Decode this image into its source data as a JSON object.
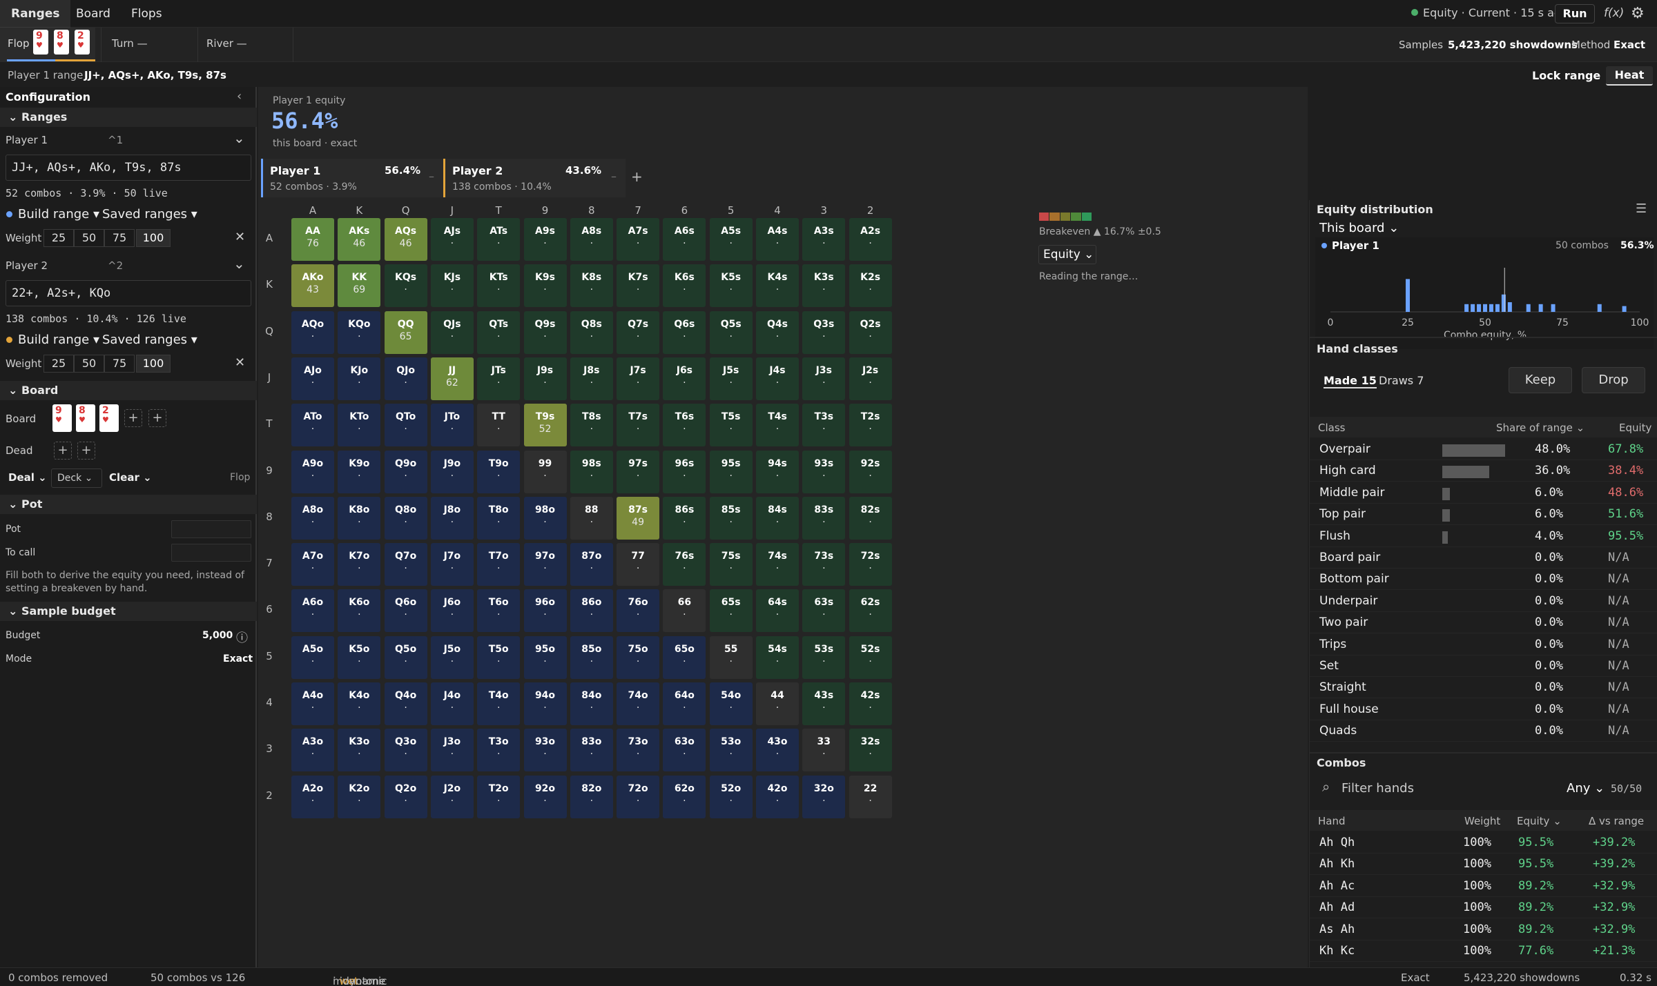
{
  "nav": {
    "tabs": [
      "Ranges",
      "Board",
      "Flops"
    ],
    "status": "Equity · Current · 15 s ago",
    "run": "Run",
    "fx": "f(x)"
  },
  "street": {
    "flop": "Flop",
    "flop_cards": [
      {
        "r": "9",
        "s": "♥"
      },
      {
        "r": "8",
        "s": "♥"
      },
      {
        "r": "2",
        "s": "♥"
      }
    ],
    "turn": "Turn —",
    "river": "River —",
    "samples_label": "Samples",
    "samples": "5,423,220 showdowns",
    "method_label": "Method",
    "method": "Exact"
  },
  "rangebar": {
    "label": "Player 1 range",
    "value": "JJ+, AQs+, AKo, T9s, 87s",
    "lock": "Lock range",
    "heat": "Heat"
  },
  "config": {
    "title": "Configuration",
    "ranges": "Ranges",
    "p1": {
      "name": "Player 1",
      "hotkey": "^1",
      "range": "JJ+, AQs+, AKo, T9s, 87s",
      "stats": "52 combos · 3.9% · 50 live",
      "build": "Build range",
      "saved": "Saved ranges"
    },
    "p2": {
      "name": "Player 2",
      "hotkey": "^2",
      "range": "22+, A2s+, KQo",
      "stats": "138 combos · 10.4% · 126 live",
      "build": "Build range",
      "saved": "Saved ranges"
    },
    "weight_label": "Weight",
    "weights": [
      "25",
      "50",
      "75",
      "100"
    ],
    "board_section": "Board",
    "board_label": "Board",
    "dead_label": "Dead",
    "deal": "Deal",
    "deck": "Deck",
    "clear": "Clear",
    "street": "Flop",
    "pot_section": "Pot",
    "pot": "Pot",
    "tocall": "To call",
    "pot_help": "Fill both to derive the equity you need, instead of setting a breakeven by hand.",
    "budget_section": "Sample budget",
    "budget_label": "Budget",
    "budget": "5,000",
    "mode_label": "Mode",
    "mode": "Exact"
  },
  "equity": {
    "label": "Player 1 equity",
    "value": "56.4%",
    "sub": "this board · exact",
    "p1": {
      "name": "Player 1",
      "pct": "56.4%",
      "sub": "52 combos · 3.9%"
    },
    "p2": {
      "name": "Player 2",
      "pct": "43.6%",
      "sub": "138 combos · 10.4%"
    },
    "breakeven": "Breakeven ▲ 16.7% ±0.5",
    "metric": "Equity",
    "reading": "Reading the range…"
  },
  "grid": {
    "ranks": [
      "A",
      "K",
      "Q",
      "J",
      "T",
      "9",
      "8",
      "7",
      "6",
      "5",
      "4",
      "3",
      "2"
    ],
    "values": {
      "AA": "76",
      "AKs": "46",
      "AQs": "46",
      "AKo": "43",
      "KK": "69",
      "QQ": "65",
      "JJ": "62",
      "T9s": "52",
      "87s": "49"
    }
  },
  "dist": {
    "title": "Equity distribution",
    "scope": "This board",
    "player": "Player 1",
    "combos": "50 combos",
    "pct": "56.3%",
    "ticks": [
      "0",
      "25",
      "50",
      "75",
      "100"
    ],
    "xlabel": "Combo equity, %",
    "bins": [
      {
        "x": 25,
        "h": 0.85
      },
      {
        "x": 44,
        "h": 0.2
      },
      {
        "x": 46,
        "h": 0.2
      },
      {
        "x": 48,
        "h": 0.2
      },
      {
        "x": 50,
        "h": 0.2
      },
      {
        "x": 52,
        "h": 0.2
      },
      {
        "x": 54,
        "h": 0.2
      },
      {
        "x": 56,
        "h": 0.45
      },
      {
        "x": 58,
        "h": 0.25
      },
      {
        "x": 64,
        "h": 0.2
      },
      {
        "x": 68,
        "h": 0.2
      },
      {
        "x": 72,
        "h": 0.2
      },
      {
        "x": 87,
        "h": 0.2
      },
      {
        "x": 95,
        "h": 0.15
      }
    ],
    "mean": 56.3
  },
  "hand_classes": {
    "title": "Hand classes",
    "made": "Made 15",
    "draws": "Draws 7",
    "keep": "Keep",
    "drop": "Drop",
    "cols": [
      "Class",
      "Share of range",
      "Equity"
    ],
    "rows": [
      [
        "Overpair",
        "48.0%",
        "67.8%",
        "g"
      ],
      [
        "High card",
        "36.0%",
        "38.4%",
        "r"
      ],
      [
        "Middle pair",
        "6.0%",
        "48.6%",
        "r"
      ],
      [
        "Top pair",
        "6.0%",
        "51.6%",
        "g"
      ],
      [
        "Flush",
        "4.0%",
        "95.5%",
        "g"
      ],
      [
        "Board pair",
        "0.0%",
        "N/A",
        "n"
      ],
      [
        "Bottom pair",
        "0.0%",
        "N/A",
        "n"
      ],
      [
        "Underpair",
        "0.0%",
        "N/A",
        "n"
      ],
      [
        "Two pair",
        "0.0%",
        "N/A",
        "n"
      ],
      [
        "Trips",
        "0.0%",
        "N/A",
        "n"
      ],
      [
        "Set",
        "0.0%",
        "N/A",
        "n"
      ],
      [
        "Straight",
        "0.0%",
        "N/A",
        "n"
      ],
      [
        "Full house",
        "0.0%",
        "N/A",
        "n"
      ],
      [
        "Quads",
        "0.0%",
        "N/A",
        "n"
      ]
    ]
  },
  "combos": {
    "title": "Combos",
    "filter": "Filter hands",
    "any": "Any",
    "count": "50/50",
    "cols": [
      "Hand",
      "Weight",
      "Equity",
      "Δ vs range"
    ],
    "rows": [
      [
        "Ah Qh",
        "100%",
        "95.5%",
        "+39.2%"
      ],
      [
        "Ah Kh",
        "100%",
        "95.5%",
        "+39.2%"
      ],
      [
        "Ah Ac",
        "100%",
        "89.2%",
        "+32.9%"
      ],
      [
        "Ah Ad",
        "100%",
        "89.2%",
        "+32.9%"
      ],
      [
        "As Ah",
        "100%",
        "89.2%",
        "+32.9%"
      ],
      [
        "Kh Kc",
        "100%",
        "77.6%",
        "+21.3%"
      ]
    ]
  },
  "status": {
    "removed": "0 combos removed",
    "vs": "50 combos vs 126",
    "texture": [
      "monotone",
      "wet",
      "dynamic"
    ],
    "mode": "Exact",
    "showdowns": "5,423,220 showdowns",
    "time": "0.32 s"
  },
  "colors": {
    "blue": "#1d2a4a",
    "green": "#1f3a2a",
    "pair": "#2f2f2f",
    "sel_olive": "#7b8a3a",
    "accent": "#6aa2ff"
  }
}
